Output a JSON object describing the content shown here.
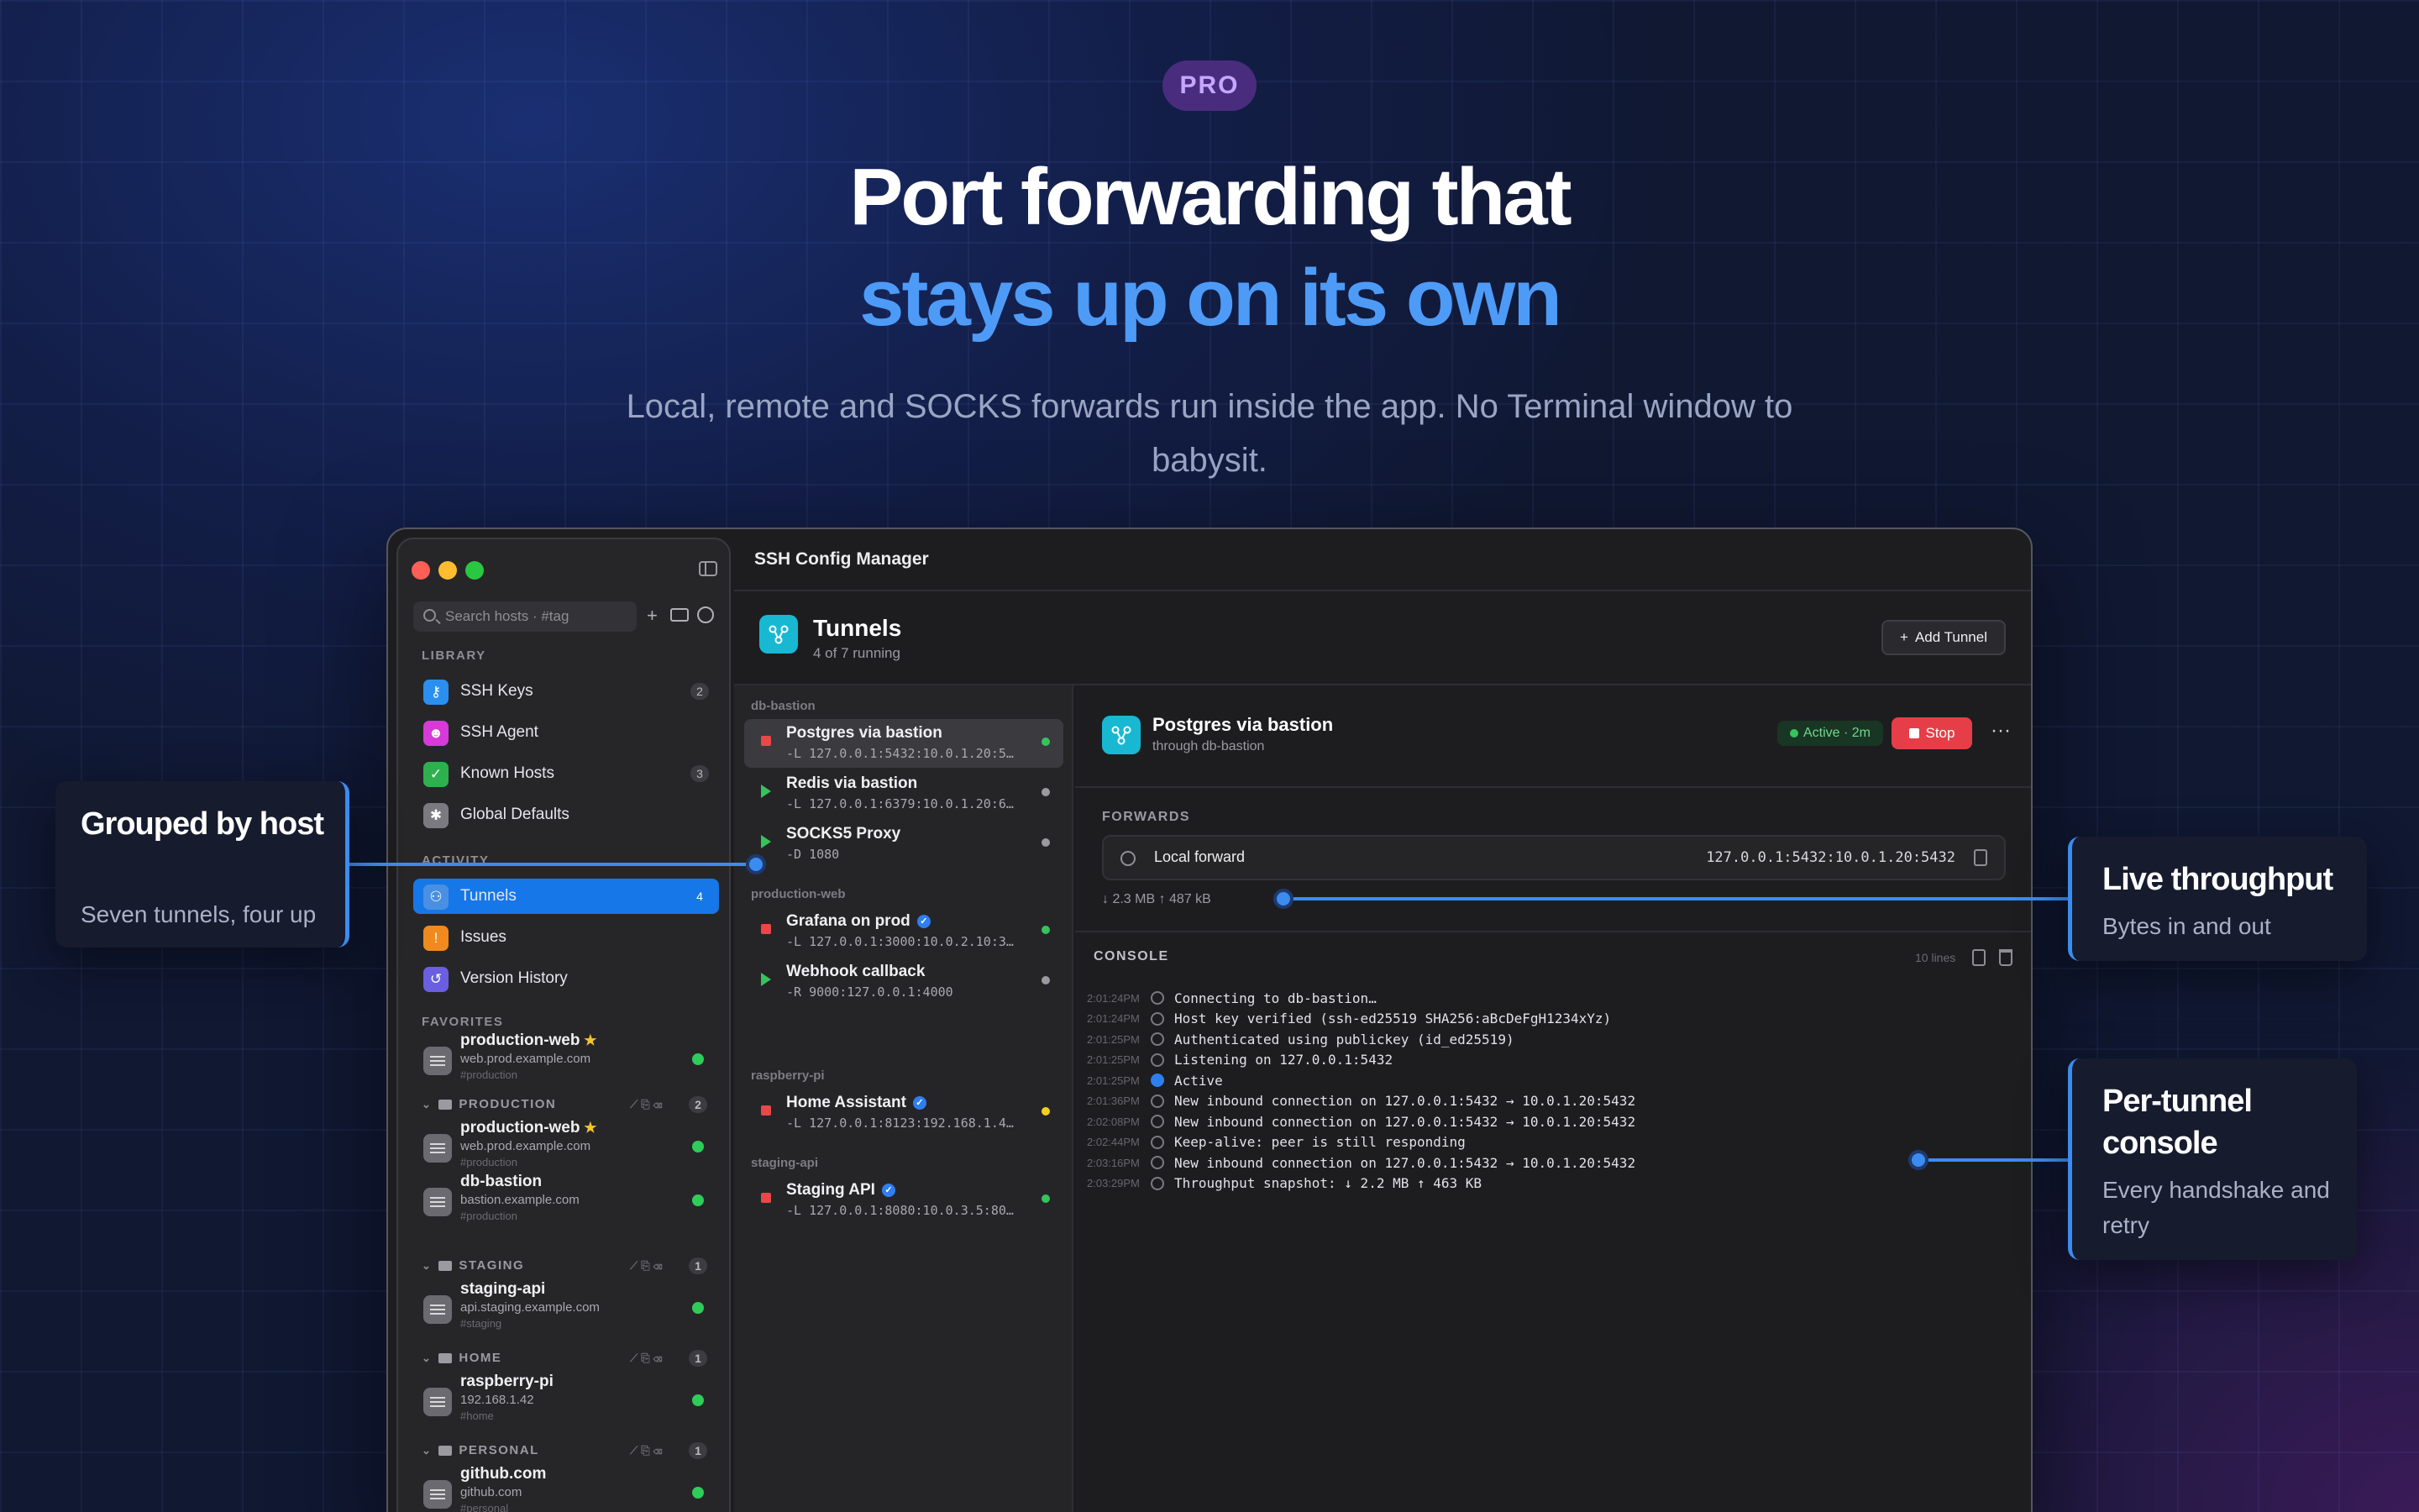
{
  "hero": {
    "badge": "PRO",
    "title_line1": "Port forwarding that",
    "title_line2": "stays up on its own",
    "subtitle": "Local, remote and SOCKS forwards run inside the app. No Terminal window to babysit."
  },
  "callouts": {
    "left": {
      "title": "Grouped by host",
      "subtitle": "Seven tunnels, four up"
    },
    "right1": {
      "title": "Live throughput",
      "subtitle": "Bytes in and out"
    },
    "right2": {
      "title": "Per-tunnel console",
      "subtitle": "Every handshake and retry"
    }
  },
  "window": {
    "title": "SSH Config Manager"
  },
  "sidebar": {
    "search_placeholder": "Search hosts · #tag",
    "library_label": "LIBRARY",
    "library": [
      {
        "label": "SSH Keys",
        "count": "2",
        "icon": "key-icon",
        "color": "#2b8ff0"
      },
      {
        "label": "SSH Agent",
        "count": "",
        "icon": "agent-icon",
        "color": "#d63ad8"
      },
      {
        "label": "Known Hosts",
        "count": "3",
        "icon": "shield-check-icon",
        "color": "#2fb04e"
      },
      {
        "label": "Global Defaults",
        "count": "",
        "icon": "asterisk-icon",
        "color": "#7a7a80"
      }
    ],
    "activity_label": "ACTIVITY",
    "activity": [
      {
        "label": "Tunnels",
        "count": "4",
        "icon": "tunnel-icon",
        "color": "#4a90e2"
      },
      {
        "label": "Issues",
        "count": "",
        "icon": "warning-icon",
        "color": "#f08a1e"
      },
      {
        "label": "Version History",
        "count": "",
        "icon": "history-icon",
        "color": "#6a5fe0"
      }
    ],
    "favorites_label": "FAVORITES",
    "favorites": [
      {
        "name": "production-web",
        "addr": "web.prod.example.com",
        "tag": "#production"
      }
    ],
    "groups": [
      {
        "name": "PRODUCTION",
        "count": "2",
        "hosts": [
          {
            "name": "production-web",
            "addr": "web.prod.example.com",
            "tag": "#production",
            "star": true
          },
          {
            "name": "db-bastion",
            "addr": "bastion.example.com",
            "tag": "#production",
            "star": false
          }
        ]
      },
      {
        "name": "STAGING",
        "count": "1",
        "hosts": [
          {
            "name": "staging-api",
            "addr": "api.staging.example.com",
            "tag": "#staging",
            "star": false
          }
        ]
      },
      {
        "name": "HOME",
        "count": "1",
        "hosts": [
          {
            "name": "raspberry-pi",
            "addr": "192.168.1.42",
            "tag": "#home",
            "star": false
          }
        ]
      },
      {
        "name": "PERSONAL",
        "count": "1",
        "hosts": [
          {
            "name": "github.com",
            "addr": "github.com",
            "tag": "#personal",
            "star": false
          }
        ]
      }
    ]
  },
  "tunnels_header": {
    "title": "Tunnels",
    "subtitle": "4 of 7 running",
    "add_label": "Add Tunnel"
  },
  "tunnel_groups": [
    {
      "name": "db-bastion",
      "tunnels": [
        {
          "name": "Postgres via bastion",
          "cmd": "-L 127.0.0.1:5432:10.0.1.20:5…",
          "state": "running",
          "status": "green",
          "verified": false
        },
        {
          "name": "Redis via bastion",
          "cmd": "-L 127.0.0.1:6379:10.0.1.20:6…",
          "state": "stopped",
          "status": "gray",
          "verified": false
        },
        {
          "name": "SOCKS5 Proxy",
          "cmd": "-D 1080",
          "state": "stopped",
          "status": "gray",
          "verified": false
        }
      ]
    },
    {
      "name": "production-web",
      "tunnels": [
        {
          "name": "Grafana on prod",
          "cmd": "-L 127.0.0.1:3000:10.0.2.10:3…",
          "state": "running",
          "status": "green",
          "verified": true
        },
        {
          "name": "Webhook callback",
          "cmd": "-R 9000:127.0.0.1:4000",
          "state": "stopped",
          "status": "gray",
          "verified": false
        }
      ]
    },
    {
      "name": "raspberry-pi",
      "tunnels": [
        {
          "name": "Home Assistant",
          "cmd": "-L 127.0.0.1:8123:192.168.1.4…",
          "state": "running",
          "status": "yellow",
          "verified": true
        }
      ]
    },
    {
      "name": "staging-api",
      "tunnels": [
        {
          "name": "Staging API",
          "cmd": "-L 127.0.0.1:8080:10.0.3.5:80…",
          "state": "running",
          "status": "green",
          "verified": true
        }
      ]
    }
  ],
  "detail": {
    "title": "Postgres via bastion",
    "subtitle": "through db-bastion",
    "status": "Active · 2m",
    "stop_label": "Stop",
    "more": "···",
    "forwards_label": "FORWARDS",
    "forward_name": "Local forward",
    "forward_addr": "127.0.0.1:5432:10.0.1.20:5432",
    "throughput": "↓ 2.3 MB  ↑ 487 kB",
    "console_label": "CONSOLE",
    "console_lines_count": "10 lines",
    "log": [
      {
        "time": "2:01:24PM",
        "text": "Connecting to db-bastion…",
        "active": false
      },
      {
        "time": "2:01:24PM",
        "text": "Host key verified (ssh-ed25519 SHA256:aBcDeFgH1234xYz)",
        "active": false
      },
      {
        "time": "2:01:25PM",
        "text": "Authenticated using publickey (id_ed25519)",
        "active": false
      },
      {
        "time": "2:01:25PM",
        "text": "Listening on 127.0.0.1:5432",
        "active": false
      },
      {
        "time": "2:01:25PM",
        "text": "Active",
        "active": true
      },
      {
        "time": "2:01:36PM",
        "text": "New inbound connection on 127.0.0.1:5432 → 10.0.1.20:5432",
        "active": false
      },
      {
        "time": "2:02:08PM",
        "text": "New inbound connection on 127.0.0.1:5432 → 10.0.1.20:5432",
        "active": false
      },
      {
        "time": "2:02:44PM",
        "text": "Keep-alive: peer is still responding",
        "active": false
      },
      {
        "time": "2:03:16PM",
        "text": "New inbound connection on 127.0.0.1:5432 → 10.0.1.20:5432",
        "active": false
      },
      {
        "time": "2:03:29PM",
        "text": "Throughput snapshot: ↓ 2.2 MB  ↑ 463 KB",
        "active": false
      }
    ]
  },
  "colors": {
    "accent": "#3b8cf0",
    "selection": "#1677e8",
    "running": "#36c35c",
    "stopped": "#e94848"
  }
}
